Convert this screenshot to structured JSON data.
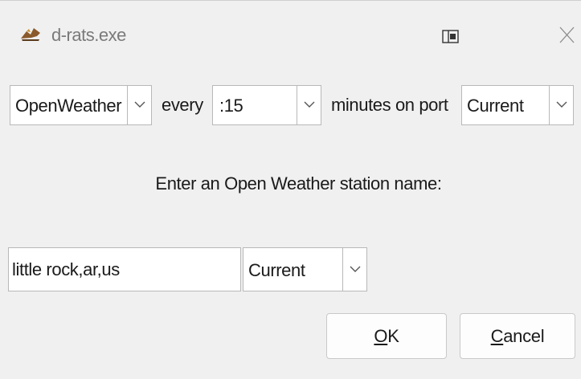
{
  "window": {
    "title": "d-rats.exe"
  },
  "row": {
    "source_selected": "OpenWeather",
    "every_label": "every",
    "interval_selected": ":15",
    "port_label": "minutes on port",
    "port_selected": "Current"
  },
  "prompt": {
    "text": "Enter an Open Weather station name:"
  },
  "station": {
    "value": "little rock,ar,us",
    "port_selected": "Current"
  },
  "buttons": {
    "ok_mnemonic": "O",
    "ok_rest": "K",
    "cancel_mnemonic": "C",
    "cancel_rest": "ancel"
  },
  "icons": {
    "app": "d-rats-app-icon",
    "pin": "window-pin-icon",
    "close": "close-icon",
    "dropdown": "chevron-down-icon"
  }
}
